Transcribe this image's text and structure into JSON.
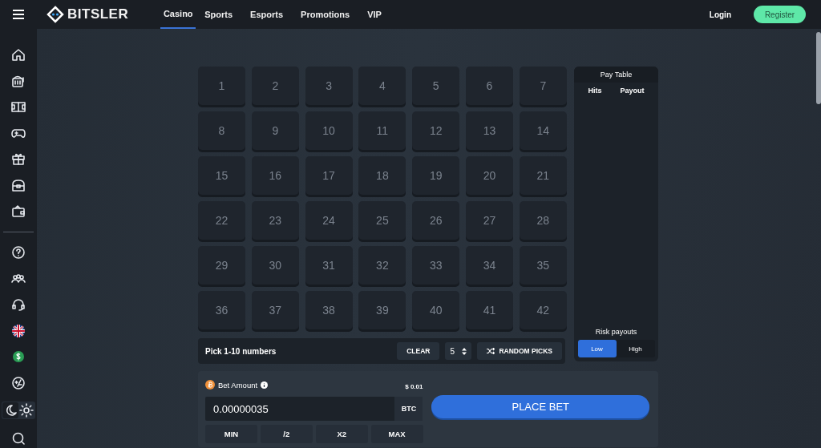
{
  "header": {
    "logo": "BITSLER",
    "nav": [
      {
        "label": "Casino",
        "selected": true
      },
      {
        "label": "Sports",
        "selected": false
      },
      {
        "label": "Esports",
        "selected": false
      },
      {
        "label": "Promotions",
        "selected": false
      },
      {
        "label": "VIP",
        "selected": false
      }
    ],
    "login": "Login",
    "register": "Register"
  },
  "sidebar": {
    "theme": [
      {
        "kind": "moon",
        "selected": true
      },
      {
        "kind": "sun",
        "selected": false
      }
    ]
  },
  "board": {
    "numbers": [
      "1",
      "2",
      "3",
      "4",
      "5",
      "6",
      "7",
      "8",
      "9",
      "10",
      "11",
      "12",
      "13",
      "14",
      "15",
      "16",
      "17",
      "18",
      "19",
      "20",
      "21",
      "22",
      "23",
      "24",
      "25",
      "26",
      "27",
      "28",
      "29",
      "30",
      "31",
      "32",
      "33",
      "34",
      "35",
      "36",
      "37",
      "38",
      "39",
      "40",
      "41",
      "42"
    ],
    "hint": "Pick 1-10 numbers",
    "clear": "CLEAR",
    "count": "5",
    "random": "RANDOM PICKS"
  },
  "pay_table": {
    "title": "Pay Table",
    "columns": [
      "Hits",
      "Payout"
    ],
    "risk_label": "Risk payouts",
    "risk": [
      {
        "label": "Low",
        "selected": true
      },
      {
        "label": "High",
        "selected": false
      }
    ]
  },
  "bet": {
    "label": "Bet Amount",
    "usd": "$ 0.01",
    "value": "0.00000035",
    "currency": "BTC",
    "quick": [
      "MIN",
      "/2",
      "X2",
      "MAX"
    ],
    "place": "PLACE BET"
  }
}
